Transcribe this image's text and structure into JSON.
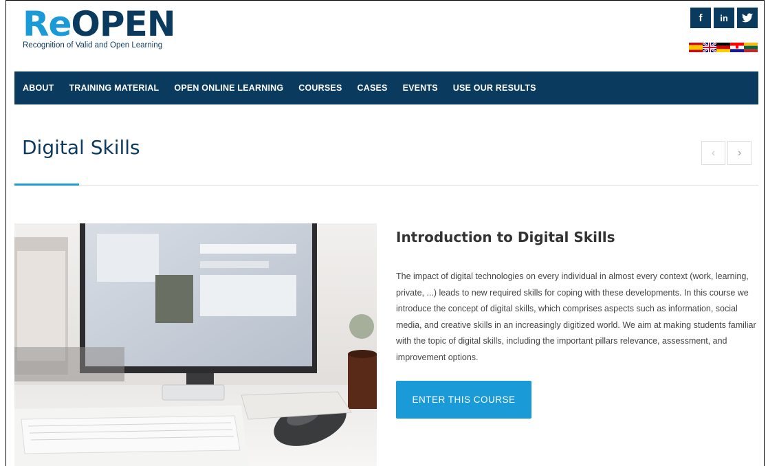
{
  "logo": {
    "part1": "Re",
    "part2": "OPEN",
    "tagline": "Recognition of Valid and Open Learning"
  },
  "social": [
    {
      "label": "f",
      "icon": "facebook-icon"
    },
    {
      "label": "in",
      "icon": "linkedin-icon"
    },
    {
      "label": "🐦",
      "icon": "twitter-icon"
    }
  ],
  "languages": [
    "es",
    "en",
    "de",
    "hr",
    "lt"
  ],
  "nav": {
    "items": [
      {
        "label": "ABOUT"
      },
      {
        "label": "TRAINING MATERIAL"
      },
      {
        "label": "OPEN ONLINE LEARNING"
      },
      {
        "label": "COURSES"
      },
      {
        "label": "CASES"
      },
      {
        "label": "EVENTS"
      },
      {
        "label": "USE OUR RESULTS"
      }
    ]
  },
  "page": {
    "title": "Digital Skills",
    "prev_icon": "‹",
    "next_icon": "›"
  },
  "course": {
    "title": "Introduction to Digital Skills",
    "description": "The impact of digital technologies on every individual in almost every context (work, learning, private, ...) leads to new required skills for coping with these developments. In this course we introduce the concept of digital skills, which comprises aspects such as information, social media, and creative skills in an increasingly digitized world. We aim at making students familiar with the topic of digital skills, including the important pillars relevance, assessment, and improvement options.",
    "button_label": "ENTER THIS COURSE"
  },
  "colors": {
    "navy": "#0b3a5f",
    "accent": "#1a9ad6"
  }
}
